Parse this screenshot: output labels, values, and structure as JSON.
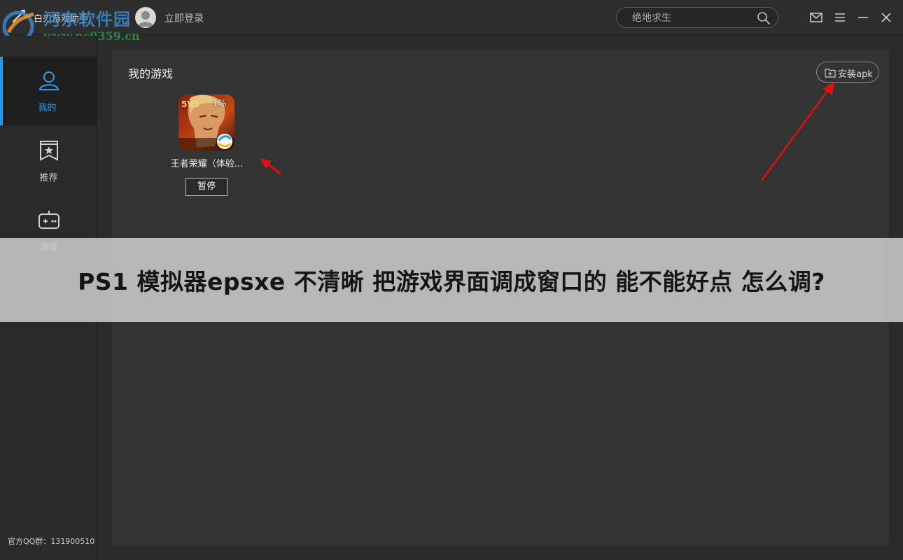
{
  "titlebar": {
    "app_name": "白刃游戏助手",
    "login_label": "立即登录",
    "search_placeholder": "绝地求生"
  },
  "watermark": {
    "brand": "河东软件园",
    "url": "www.pc0359.cn"
  },
  "sidebar": {
    "items": [
      {
        "label": "我的",
        "icon": "user-icon",
        "active": true
      },
      {
        "label": "推荐",
        "icon": "star-bookmark-icon",
        "active": false
      },
      {
        "label": "游戏",
        "icon": "gamepad-icon",
        "active": false
      }
    ],
    "qq_group": "官方QQ群：131900510"
  },
  "main": {
    "title": "我的游戏",
    "install_label": "安装apk",
    "game": {
      "name": "王者荣耀（体验...",
      "progress": "1%",
      "pause_label": "暂停"
    }
  },
  "caption": "PS1 模拟器epsxe 不清晰 把游戏界面调成窗口的 能不能好点 怎么调?",
  "colors": {
    "accent": "#1e9bf0",
    "arrow": "#e01010",
    "background": "#2b2b2b",
    "panel": "#333333"
  }
}
